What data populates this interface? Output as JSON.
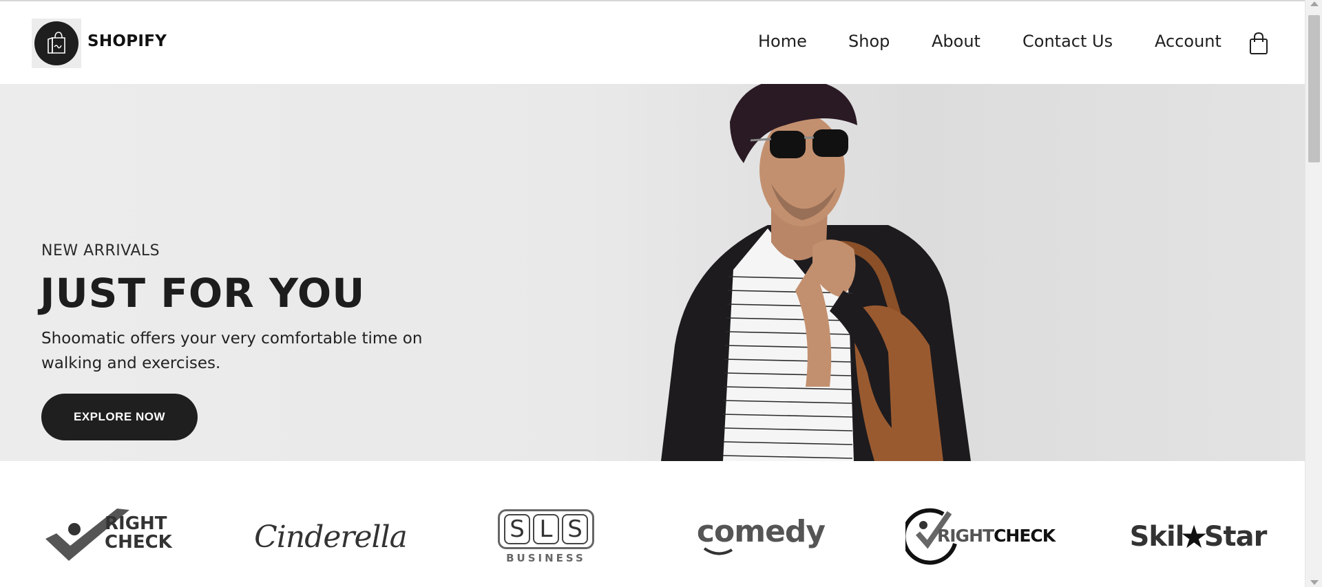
{
  "header": {
    "brand": "SHOPIFY",
    "logo_icon": "shopping-bag-icon",
    "nav": [
      {
        "label": "Home"
      },
      {
        "label": "Shop"
      },
      {
        "label": "About"
      },
      {
        "label": "Contact Us"
      },
      {
        "label": "Account"
      }
    ],
    "cart_icon": "shopping-bag-icon"
  },
  "hero": {
    "eyebrow": "NEW ARRIVALS",
    "title": "JUST FOR YOU",
    "description": "Shoomatic offers your very comfortable time on walking and exercises.",
    "cta_label": "EXPLORE NOW"
  },
  "brands": [
    {
      "name": "RightCheck",
      "line1": "RIGHT",
      "line2": "CHECK"
    },
    {
      "name": "Cinderella",
      "text": "Cinderella"
    },
    {
      "name": "SLS Business",
      "letters": [
        "S",
        "L",
        "S"
      ],
      "sub": "BUSINESS"
    },
    {
      "name": "comedy",
      "text": "comedy"
    },
    {
      "name": "RightCheck 2",
      "part1": "RIGHT",
      "part2": "CHECK"
    },
    {
      "name": "SkillStar",
      "part1": "Skil",
      "part2": "Star"
    }
  ],
  "colors": {
    "primary_dark": "#1f1f1f",
    "hero_bg": "#e9e9e9",
    "text": "#222222"
  }
}
